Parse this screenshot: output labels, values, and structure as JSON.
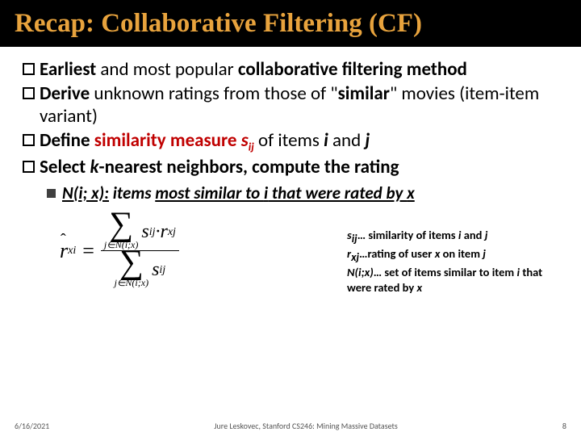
{
  "title": "Recap: Collaborative Filtering (CF)",
  "b1a": "Earliest",
  "b1b": " and most popular ",
  "b1c": "collaborative filtering method",
  "b2a": "Derive",
  "b2b": " unknown ratings from those of \"",
  "b2c": "similar",
  "b2d": "\" movies (item-item variant)",
  "b3a": "Define ",
  "b3b": "similarity measure ",
  "b3c": "s",
  "b3c_sub": "ij",
  "b3d": " of items ",
  "b3e": "i",
  "b3f": " and ",
  "b3g": "j",
  "b4a": "Select ",
  "b4b": "k",
  "b4c": "-nearest neighbors, compute the rating",
  "sub_a": "N(i; x):",
  "sub_b": " items ",
  "sub_c": "most similar to ",
  "sub_d": "i",
  "sub_e": " that were rated by ",
  "sub_f": "x",
  "formula": {
    "lhs_var": "r",
    "lhs_sub": "xi",
    "eq": "=",
    "sum_sub": "j∈N(i;x)",
    "s": "s",
    "s_sub": "ij",
    "dot": " · ",
    "r": "r",
    "r_sub": "xj"
  },
  "legend": {
    "l1a": "s",
    "l1a_sub": "ij",
    "l1b": "… similarity of items ",
    "l1c": "i",
    "l1d": " and ",
    "l1e": "j",
    "l2a": "r",
    "l2a_sub": "xj",
    "l2b": "…rating of user ",
    "l2c": "x",
    "l2d": " on item ",
    "l2e": "j",
    "l3a": "N(i;x)",
    "l3b": "… set of items similar to item ",
    "l3c": "i",
    "l3d": " that were rated by ",
    "l3e": "x"
  },
  "footer": {
    "date": "6/16/2021",
    "center": "Jure Leskovec, Stanford CS246: Mining Massive Datasets",
    "page": "8"
  }
}
